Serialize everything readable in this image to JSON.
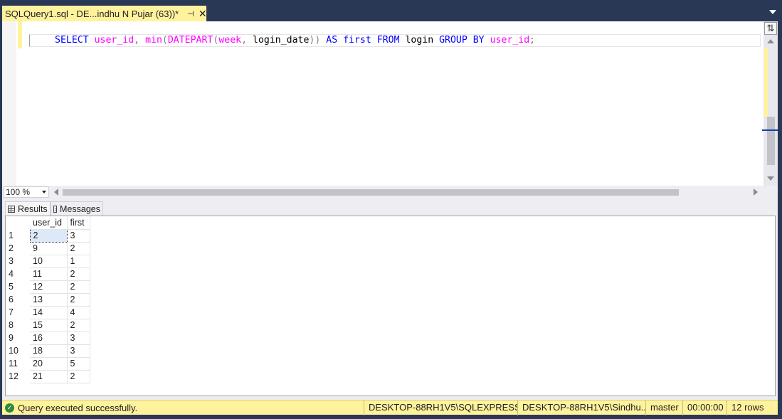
{
  "tab": {
    "title": "SQLQuery1.sql - DE...indhu N Pujar (63))*",
    "pin_glyph": "⊣",
    "close_glyph": "✕"
  },
  "editor": {
    "tokens": [
      {
        "t": "SELECT",
        "c": "kw"
      },
      {
        "t": " ",
        "c": "id"
      },
      {
        "t": "user_id",
        "c": "fn"
      },
      {
        "t": ",",
        "c": "op"
      },
      {
        "t": " ",
        "c": "id"
      },
      {
        "t": "min",
        "c": "fn"
      },
      {
        "t": "(",
        "c": "op"
      },
      {
        "t": "DATEPART",
        "c": "fn"
      },
      {
        "t": "(",
        "c": "op"
      },
      {
        "t": "week",
        "c": "fn"
      },
      {
        "t": ",",
        "c": "op"
      },
      {
        "t": " login_date",
        "c": "id"
      },
      {
        "t": "))",
        "c": "op"
      },
      {
        "t": " ",
        "c": "id"
      },
      {
        "t": "AS",
        "c": "kw"
      },
      {
        "t": " ",
        "c": "id"
      },
      {
        "t": "first",
        "c": "kw"
      },
      {
        "t": " ",
        "c": "id"
      },
      {
        "t": "FROM",
        "c": "kw"
      },
      {
        "t": " login ",
        "c": "id"
      },
      {
        "t": "GROUP BY",
        "c": "kw"
      },
      {
        "t": " ",
        "c": "id"
      },
      {
        "t": "user_id",
        "c": "fn"
      },
      {
        "t": ";",
        "c": "op"
      }
    ]
  },
  "zoom": {
    "value": "100 %"
  },
  "result_tabs": {
    "results": "Results",
    "messages": "Messages"
  },
  "grid": {
    "columns": [
      "user_id",
      "first"
    ],
    "rows": [
      [
        "1",
        "2",
        "3"
      ],
      [
        "2",
        "9",
        "2"
      ],
      [
        "3",
        "10",
        "1"
      ],
      [
        "4",
        "11",
        "2"
      ],
      [
        "5",
        "12",
        "2"
      ],
      [
        "6",
        "13",
        "2"
      ],
      [
        "7",
        "14",
        "4"
      ],
      [
        "8",
        "15",
        "2"
      ],
      [
        "9",
        "16",
        "3"
      ],
      [
        "10",
        "18",
        "3"
      ],
      [
        "11",
        "20",
        "5"
      ],
      [
        "12",
        "21",
        "2"
      ]
    ]
  },
  "status": {
    "message": "Query executed successfully.",
    "server": "DESKTOP-88RH1V5\\SQLEXPRESS ...",
    "user": "DESKTOP-88RH1V5\\Sindhu...",
    "database": "master",
    "elapsed": "00:00:00",
    "rows": "12 rows"
  },
  "icons": {
    "split": "split-view-icon",
    "status_ok": "check-circle-icon",
    "results": "grid-icon",
    "messages": "message-icon"
  },
  "colors": {
    "tab_active": "#fff29d",
    "chrome": "#293955",
    "keyword": "#0000ff",
    "function": "#ff00ff",
    "operator": "#808080",
    "success": "#2f8a3c"
  }
}
